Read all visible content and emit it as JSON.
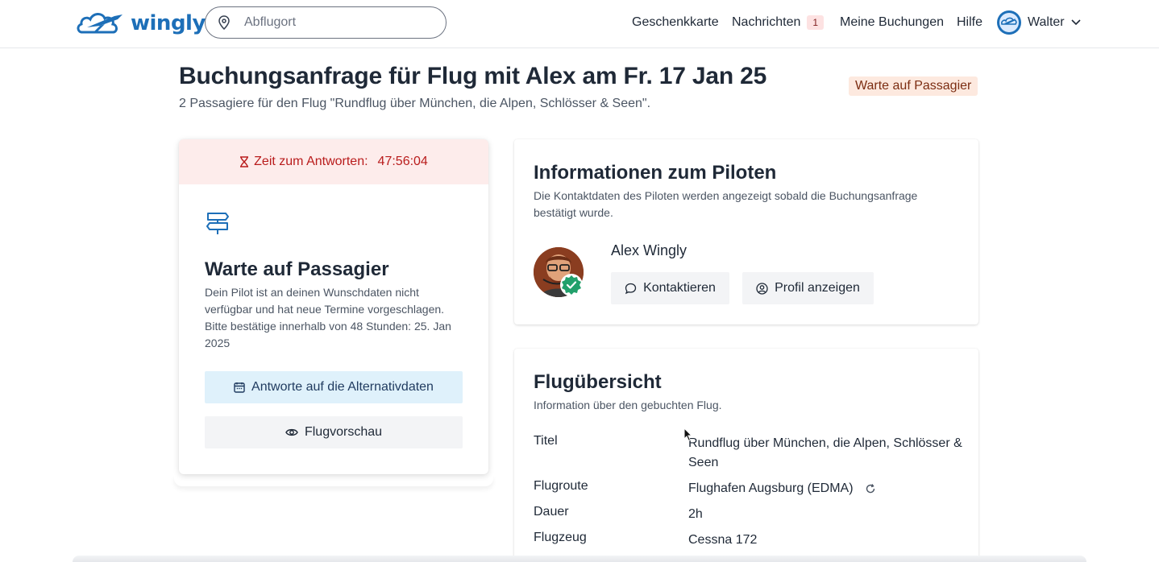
{
  "header": {
    "logo_text": "wingly",
    "search_placeholder": "Abflugort",
    "nav": {
      "gift_card": "Geschenkkarte",
      "messages": "Nachrichten",
      "messages_count": "1",
      "bookings": "Meine Buchungen",
      "help": "Hilfe",
      "user_name": "Walter"
    }
  },
  "page": {
    "title": "Buchungsanfrage für Flug mit Alex am Fr. 17 Jan 25",
    "subtitle": "2 Passagiere für den Flug \"Rundflug über München, die Alpen, Schlösser & Seen\".",
    "status": "Warte auf Passagier"
  },
  "left_card": {
    "timer_label": "Zeit zum Antworten:",
    "timer_value": "47:56:04",
    "title": "Warte auf Passagier",
    "description": "Dein Pilot ist an deinen Wunschdaten nicht verfügbar und hat neue Termine vorgeschlagen. Bitte bestätige innerhalb von 48 Stunden: 25. Jan 2025",
    "primary_button": "Antworte auf die Alternativdaten",
    "secondary_button": "Flugvorschau"
  },
  "pilot_card": {
    "title": "Informationen zum Piloten",
    "description": "Die Kontaktdaten des Piloten werden angezeigt sobald die Buchungsanfrage bestätigt wurde.",
    "pilot_name": "Alex Wingly",
    "contact_button": "Kontaktieren",
    "profile_button": "Profil anzeigen"
  },
  "flight_card": {
    "title": "Flugübersicht",
    "description": "Information über den gebuchten Flug.",
    "rows": [
      {
        "label": "Titel",
        "value": "Rundflug über München, die Alpen, Schlösser & Seen"
      },
      {
        "label": "Flugroute",
        "value": "Flughafen Augsburg (EDMA)"
      },
      {
        "label": "Dauer",
        "value": "2h"
      },
      {
        "label": "Flugzeug",
        "value": "Cessna 172"
      }
    ]
  },
  "colors": {
    "brand": "#1d6fb8",
    "timer_text": "#b91c1c",
    "timer_bg": "#fdeceb",
    "status_bg": "#fde9df",
    "primary_btn_bg": "#dff1fb",
    "verified_green": "#22a06b"
  },
  "icons": {
    "logo": "airplane-cloud-icon",
    "search": "map-pin-icon",
    "chevron": "chevron-down-icon",
    "timer": "hourglass-icon",
    "sign": "signpost-icon",
    "calendar": "calendar-icon",
    "preview": "eye-icon",
    "contact": "chat-bubble-icon",
    "profile": "user-circle-icon",
    "verified": "verified-badge-icon",
    "refresh": "refresh-icon"
  }
}
